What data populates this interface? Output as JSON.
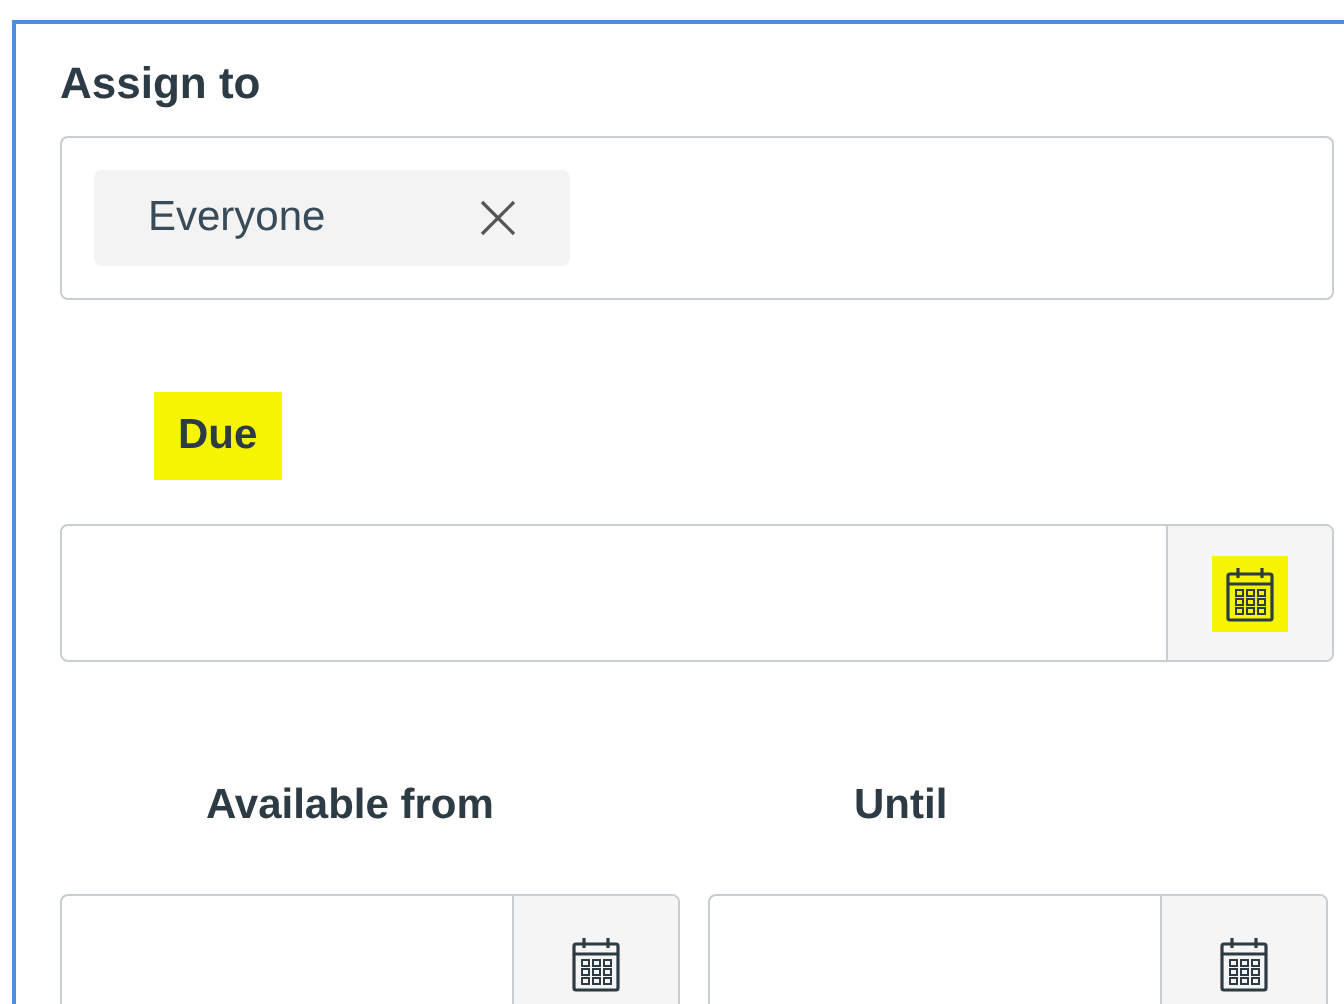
{
  "assign_to": {
    "label": "Assign to",
    "chips": [
      {
        "label": "Everyone"
      }
    ]
  },
  "date_fields": [
    {
      "label": "Due",
      "label_highlighted": true,
      "button_highlighted": true
    },
    {
      "label": "Available from",
      "label_highlighted": false,
      "button_highlighted": false
    },
    {
      "label": "Until",
      "label_highlighted": false,
      "button_highlighted": false
    }
  ]
}
